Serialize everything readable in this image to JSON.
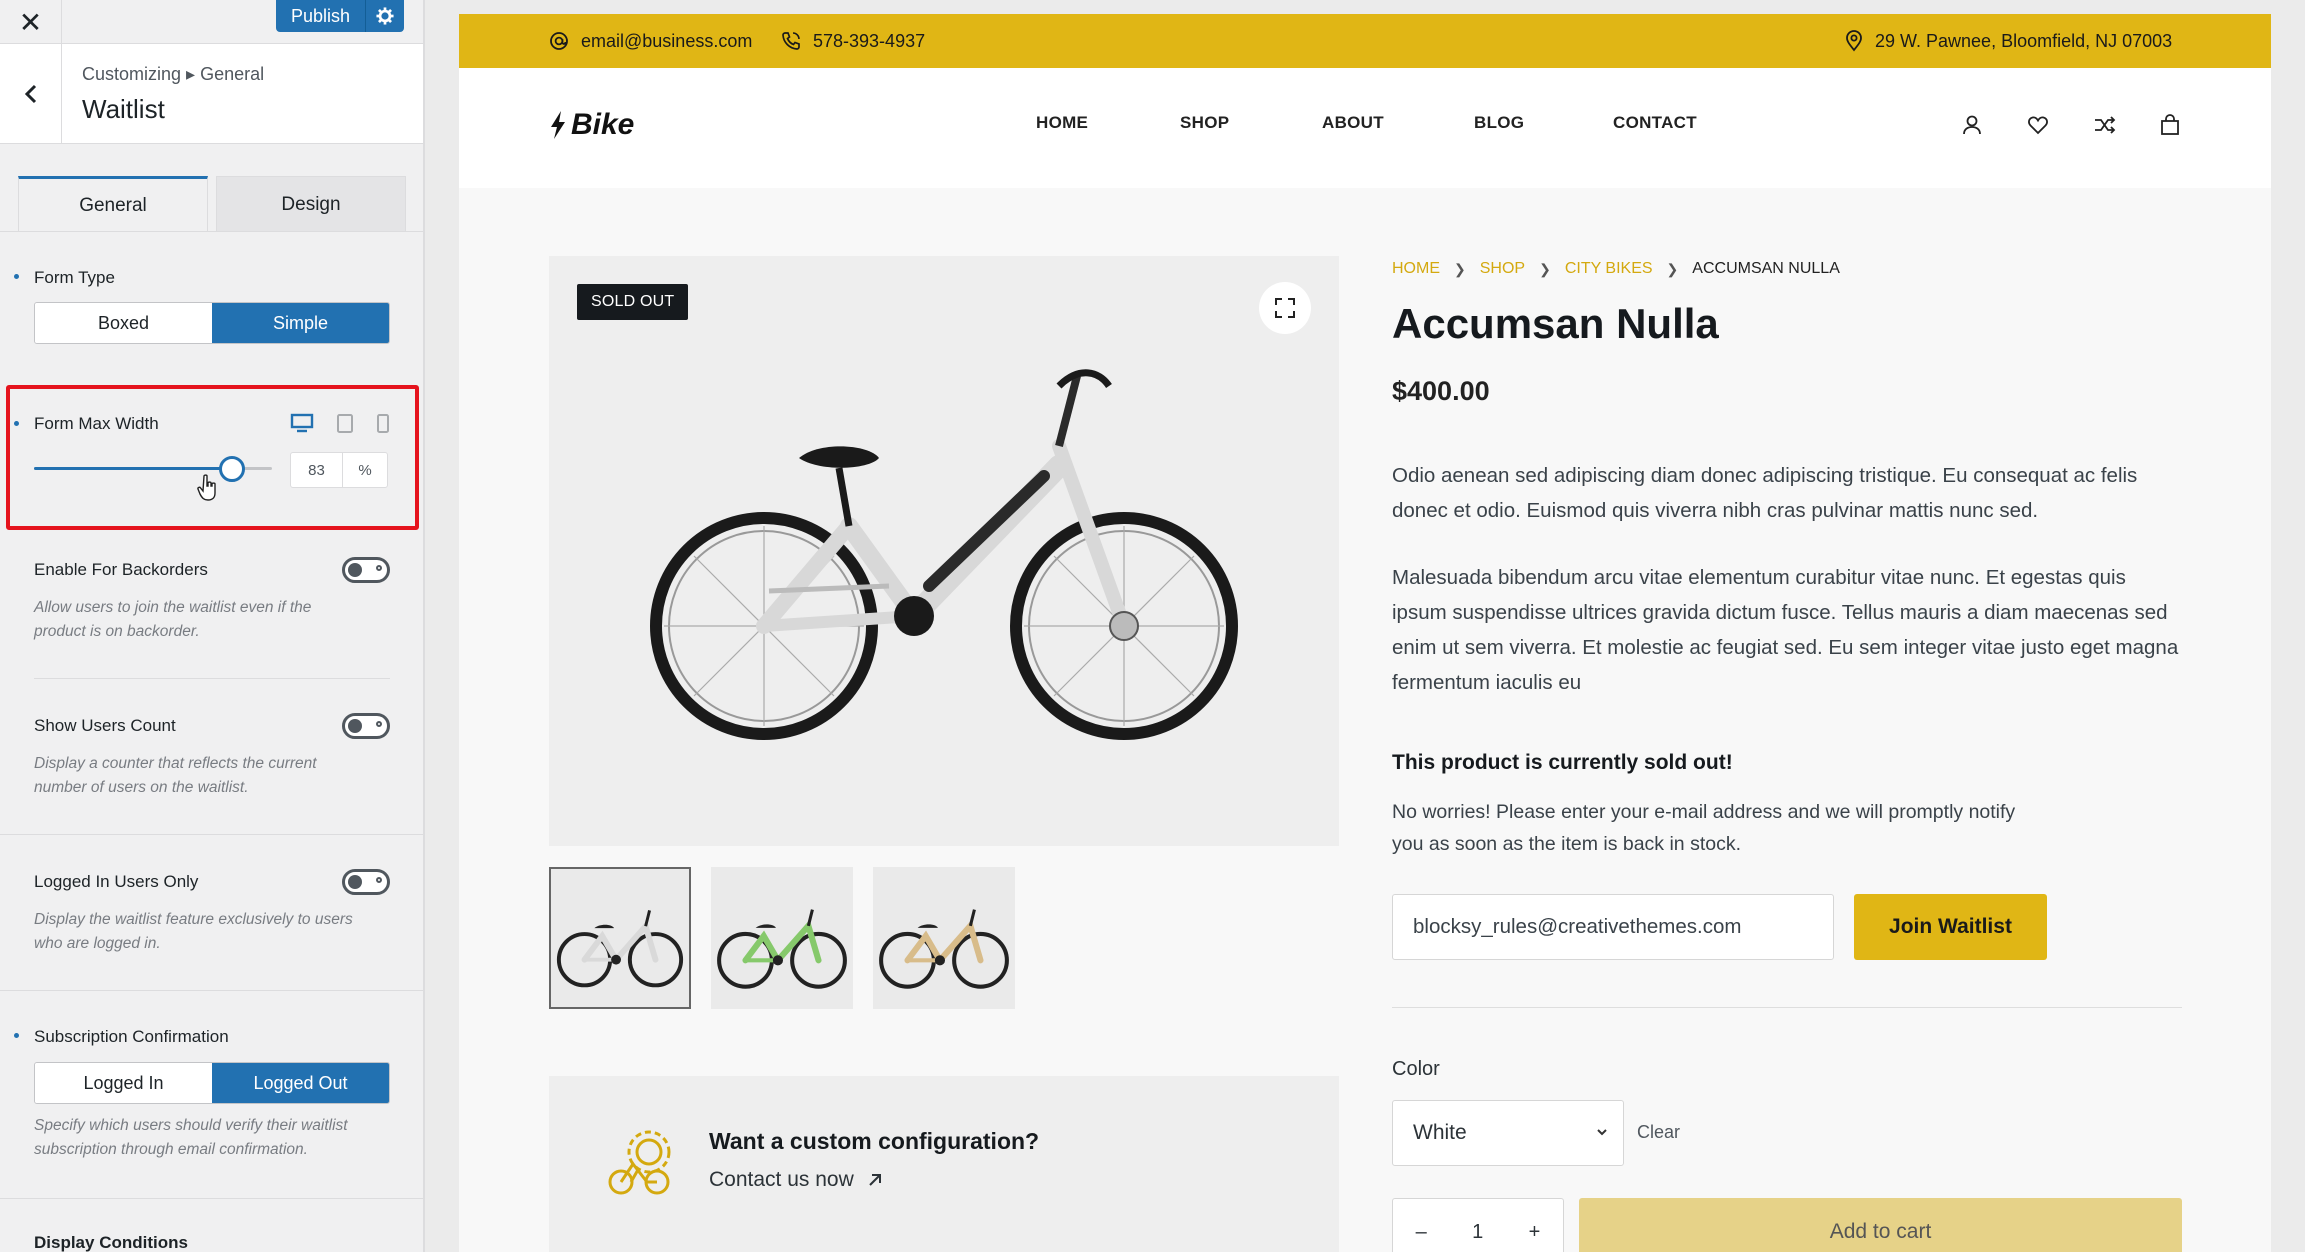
{
  "customizer": {
    "publish_label": "Publish",
    "breadcrumb": "Customizing ▸ General",
    "panel_title": "Waitlist",
    "tabs": [
      {
        "label": "General",
        "active": true
      },
      {
        "label": "Design",
        "active": false
      }
    ],
    "form_type": {
      "label": "Form Type",
      "options": [
        "Boxed",
        "Simple"
      ],
      "selected": "Simple"
    },
    "form_max_width": {
      "label": "Form Max Width",
      "value": "83",
      "unit": "%",
      "slider_fraction": 0.83
    },
    "backorders": {
      "label": "Enable For Backorders",
      "desc": "Allow users to join the waitlist even if the product is on backorder.",
      "enabled": false
    },
    "users_count": {
      "label": "Show Users Count",
      "desc": "Display a counter that reflects the current number of users on the waitlist.",
      "enabled": false
    },
    "logged_in_only": {
      "label": "Logged In Users Only",
      "desc": "Display the waitlist feature exclusively to users who are logged in.",
      "enabled": false
    },
    "subscription": {
      "label": "Subscription Confirmation",
      "options": [
        "Logged In",
        "Logged Out"
      ],
      "selected": "Logged Out",
      "desc": "Specify which users should verify their waitlist subscription through email confirmation."
    },
    "display_conditions_label": "Display Conditions"
  },
  "site": {
    "topbar": {
      "email": "email@business.com",
      "phone": "578-393-4937",
      "address": "29 W. Pawnee, Bloomfield, NJ 07003"
    },
    "logo": "Bike",
    "nav": [
      "HOME",
      "SHOP",
      "ABOUT",
      "BLOG",
      "CONTACT"
    ],
    "accent_color": "#e0b615"
  },
  "product": {
    "badge": "SOLD OUT",
    "breadcrumb": [
      "HOME",
      "SHOP",
      "CITY BIKES",
      "ACCUMSAN NULLA"
    ],
    "title": "Accumsan Nulla",
    "price": "$400.00",
    "description_1": "Odio aenean sed adipiscing diam donec adipiscing tristique. Eu consequat ac felis donec et odio. Euismod quis viverra nibh cras pulvinar mattis nunc sed.",
    "description_2": "Malesuada bibendum arcu vitae elementum curabitur vitae nunc. Et egestas quis ipsum suspendisse ultrices gravida dictum fusce. Tellus mauris a diam maecenas sed enim ut sem viverra. Et molestie ac feugiat sed. Eu sem integer vitae justo eget magna fermentum iaculis eu",
    "sold_out_heading": "This product is currently sold out!",
    "sold_out_note": "No worries! Please enter your e-mail address and we will promptly notify you as soon as the item is back in stock.",
    "email_value": "blocksy_rules@creativethemes.com",
    "join_label": "Join Waitlist",
    "color_label": "Color",
    "color_value": "White",
    "clear_label": "Clear",
    "qty_minus": "–",
    "qty": "1",
    "qty_plus": "+",
    "add_to_cart": "Add to cart",
    "thumb_colors": [
      "#d9d9d9",
      "#86c96b",
      "#d8bc8a"
    ]
  },
  "promo": {
    "title": "Want a custom configuration?",
    "link": "Contact us now"
  }
}
